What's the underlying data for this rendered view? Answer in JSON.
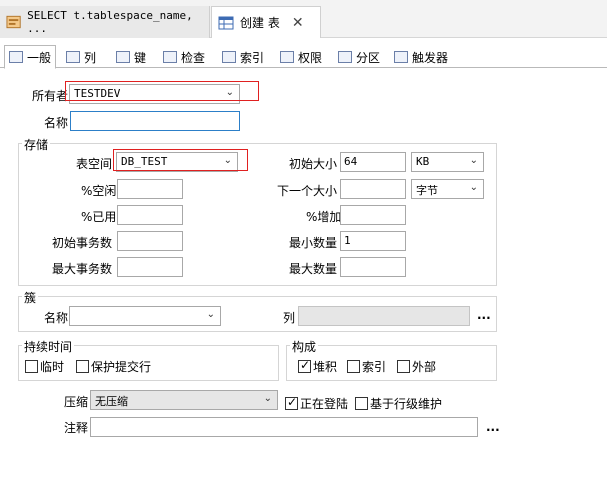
{
  "doc_tabs": [
    {
      "label": "SELECT t.tablespace_name,  ...",
      "icon": "query-icon"
    },
    {
      "label": "创建 表",
      "icon": "table-icon",
      "close": "✕"
    }
  ],
  "sub_tabs": [
    "一般",
    "列",
    "键",
    "检查",
    "索引",
    "权限",
    "分区",
    "触发器"
  ],
  "owner": {
    "label": "所有者",
    "value": "TESTDEV"
  },
  "name": {
    "label": "名称",
    "value": ""
  },
  "storage": {
    "title": "存储",
    "tablespace": {
      "label": "表空间",
      "value": "DB_TEST"
    },
    "pct_free": {
      "label": "%空闲",
      "value": ""
    },
    "pct_used": {
      "label": "%已用",
      "value": ""
    },
    "initial_trans": {
      "label": "初始事务数",
      "value": ""
    },
    "max_trans": {
      "label": "最大事务数",
      "value": ""
    },
    "initial_size": {
      "label": "初始大小",
      "value": "64",
      "unit": "KB"
    },
    "next_size": {
      "label": "下一个大小",
      "value": "",
      "unit": "字节"
    },
    "pct_increase": {
      "label": "%增加",
      "value": ""
    },
    "min_extents": {
      "label": "最小数量",
      "value": "1"
    },
    "max_extents": {
      "label": "最大数量",
      "value": ""
    }
  },
  "cluster": {
    "title": "簇",
    "name_label": "名称",
    "name_value": "",
    "columns_label": "列",
    "columns_value": "",
    "ellipsis": "..."
  },
  "duration": {
    "title": "持续时间",
    "temporary": "临时",
    "preserve_commit": "保护提交行"
  },
  "organization": {
    "title": "构成",
    "heap": "堆积",
    "index": "索引",
    "external": "外部"
  },
  "compression": {
    "label": "压缩",
    "value": "无压缩"
  },
  "logging": {
    "label": "正在登陆",
    "checked": true
  },
  "row_movement": {
    "label": "基于行级维护",
    "checked": false
  },
  "comment": {
    "label": "注释",
    "value": "",
    "ellipsis": "..."
  }
}
